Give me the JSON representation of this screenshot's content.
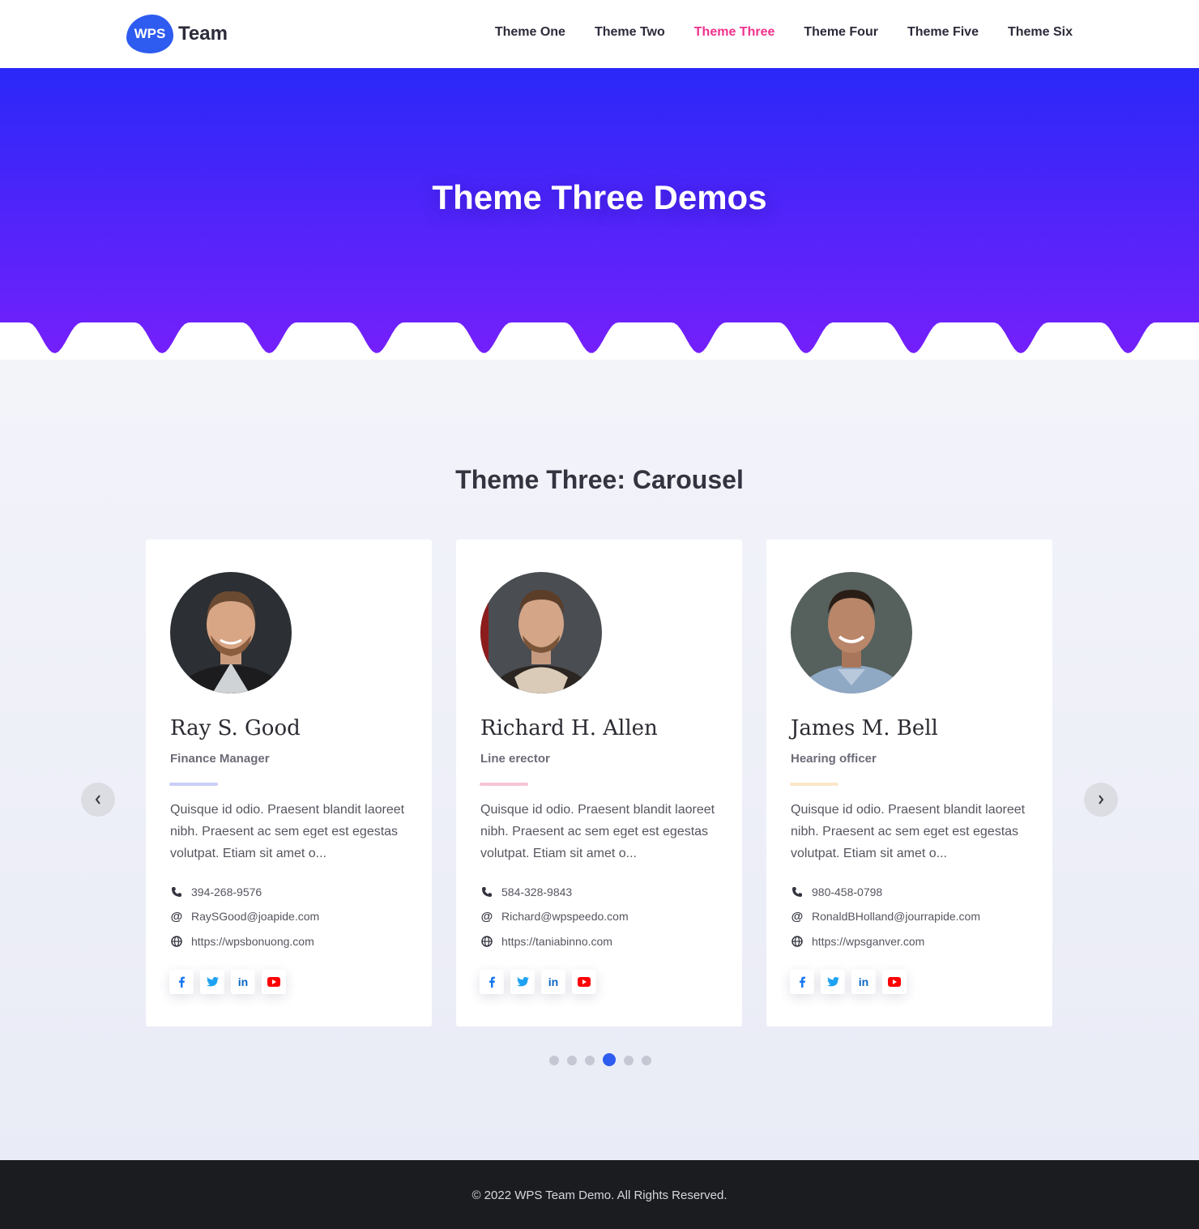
{
  "header": {
    "logo_badge": "WPS",
    "logo_text": "Team",
    "nav": [
      {
        "label": "Theme One",
        "active": false
      },
      {
        "label": "Theme Two",
        "active": false
      },
      {
        "label": "Theme Three",
        "active": true
      },
      {
        "label": "Theme Four",
        "active": false
      },
      {
        "label": "Theme Five",
        "active": false
      },
      {
        "label": "Theme Six",
        "active": false
      }
    ]
  },
  "hero": {
    "title": "Theme Three Demos",
    "gradient_top": "#2a28f8",
    "gradient_bottom": "#7420fb"
  },
  "section": {
    "title": "Theme Three: Carousel"
  },
  "members": [
    {
      "name": "Ray S. Good",
      "role": "Finance Manager",
      "accent": "#c9cff8",
      "bio": "Quisque id odio. Praesent blandit laoreet nibh. Praesent ac sem eget est egestas volutpat. Etiam sit amet o...",
      "phone": "394-268-9576",
      "email": "RaySGood@joapide.com",
      "website": "https://wpsbonuong.com"
    },
    {
      "name": "Richard H. Allen",
      "role": "Line erector",
      "accent": "#f8c4d4",
      "bio": "Quisque id odio. Praesent blandit laoreet nibh. Praesent ac sem eget est egestas volutpat. Etiam sit amet o...",
      "phone": "584-328-9843",
      "email": "Richard@wpspeedo.com",
      "website": "https://taniabinno.com"
    },
    {
      "name": "James M. Bell",
      "role": "Hearing officer",
      "accent": "#fbe6c8",
      "bio": "Quisque id odio. Praesent blandit laoreet nibh. Praesent ac sem eget est egestas volutpat. Etiam sit amet o...",
      "phone": "980-458-0798",
      "email": "RonaldBHolland@jourrapide.com",
      "website": "https://wpsganver.com"
    }
  ],
  "social_icons": [
    "facebook-icon",
    "twitter-icon",
    "linkedin-icon",
    "youtube-icon"
  ],
  "carousel": {
    "pages": 6,
    "active_page": 4
  },
  "footer": {
    "text": "© 2022 WPS Team Demo. All Rights Reserved."
  }
}
